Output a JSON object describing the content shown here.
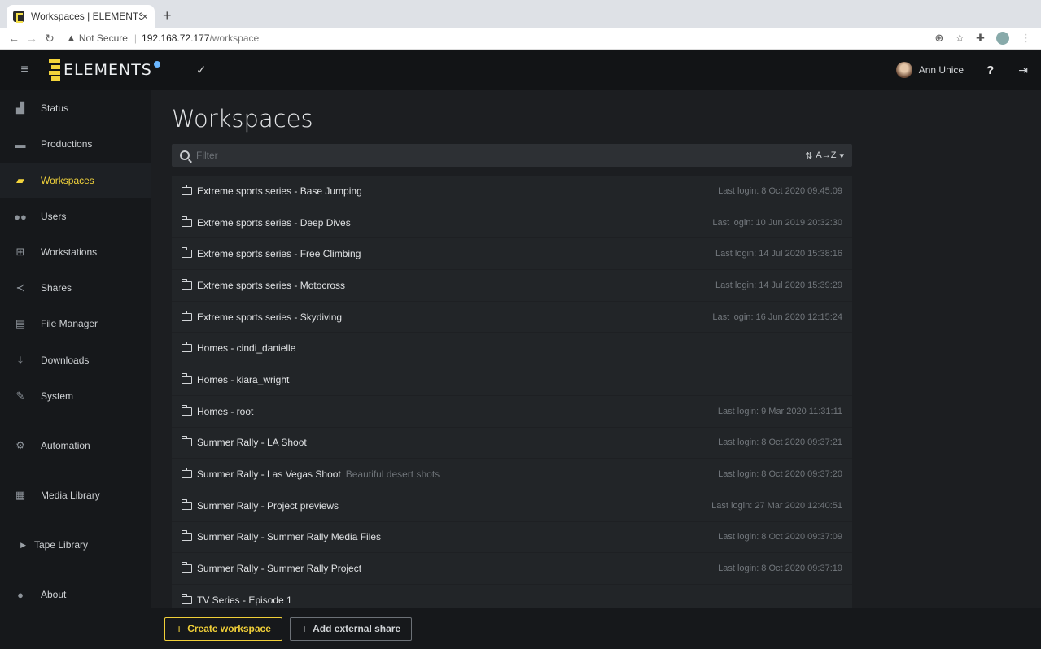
{
  "browser": {
    "tab_title": "Workspaces | ELEMENTS",
    "tab_close": "×",
    "new_tab": "+",
    "not_secure": "Not Secure",
    "url_host": "192.168.72.177",
    "url_path": "/workspace"
  },
  "header": {
    "logo_text": "ELEMENTS",
    "user_name": "Ann Unice",
    "help": "?"
  },
  "sidebar": {
    "items": [
      {
        "label": "Status",
        "icon": "chart-icon"
      },
      {
        "label": "Productions",
        "icon": "briefcase-icon"
      },
      {
        "label": "Workspaces",
        "icon": "folder-open-icon",
        "active": true
      },
      {
        "label": "Users",
        "icon": "users-icon"
      },
      {
        "label": "Workstations",
        "icon": "network-icon"
      },
      {
        "label": "Shares",
        "icon": "share-icon"
      },
      {
        "label": "File Manager",
        "icon": "files-icon"
      },
      {
        "label": "Downloads",
        "icon": "download-icon"
      },
      {
        "label": "System",
        "icon": "wrench-icon"
      },
      {
        "label": "Automation",
        "icon": "gears-icon"
      },
      {
        "label": "Media Library",
        "icon": "film-icon"
      },
      {
        "label": "Tape Library",
        "icon": "caret-right-icon"
      },
      {
        "label": "About",
        "icon": "info-icon"
      }
    ]
  },
  "main": {
    "title": "Workspaces",
    "filter_placeholder": "Filter",
    "sort_label": "A→Z",
    "workspaces": [
      {
        "name": "Extreme sports series - Base Jumping",
        "desc": "",
        "login": "Last login: 8 Oct 2020 09:45:09"
      },
      {
        "name": "Extreme sports series - Deep Dives",
        "desc": "",
        "login": "Last login: 10 Jun 2019 20:32:30"
      },
      {
        "name": "Extreme sports series - Free Climbing",
        "desc": "",
        "login": "Last login: 14 Jul 2020 15:38:16"
      },
      {
        "name": "Extreme sports series - Motocross",
        "desc": "",
        "login": "Last login: 14 Jul 2020 15:39:29"
      },
      {
        "name": "Extreme sports series - Skydiving",
        "desc": "",
        "login": "Last login: 16 Jun 2020 12:15:24"
      },
      {
        "name": "Homes - cindi_danielle",
        "desc": "",
        "login": ""
      },
      {
        "name": "Homes - kiara_wright",
        "desc": "",
        "login": ""
      },
      {
        "name": "Homes - root",
        "desc": "",
        "login": "Last login: 9 Mar 2020 11:31:11"
      },
      {
        "name": "Summer Rally - LA Shoot",
        "desc": "",
        "login": "Last login: 8 Oct 2020 09:37:21"
      },
      {
        "name": "Summer Rally - Las Vegas Shoot",
        "desc": "Beautiful desert shots",
        "login": "Last login: 8 Oct 2020 09:37:20"
      },
      {
        "name": "Summer Rally - Project previews",
        "desc": "",
        "login": "Last login: 27 Mar 2020 12:40:51"
      },
      {
        "name": "Summer Rally - Summer Rally Media Files",
        "desc": "",
        "login": "Last login: 8 Oct 2020 09:37:09"
      },
      {
        "name": "Summer Rally - Summer Rally Project",
        "desc": "",
        "login": "Last login: 8 Oct 2020 09:37:19"
      },
      {
        "name": "TV Series - Episode 1",
        "desc": "",
        "login": ""
      }
    ]
  },
  "footer": {
    "create_label": "Create workspace",
    "external_label": "Add external share"
  },
  "colors": {
    "accent": "#f0cf38",
    "background": "#1c1e21",
    "sidebar": "#16181b"
  }
}
